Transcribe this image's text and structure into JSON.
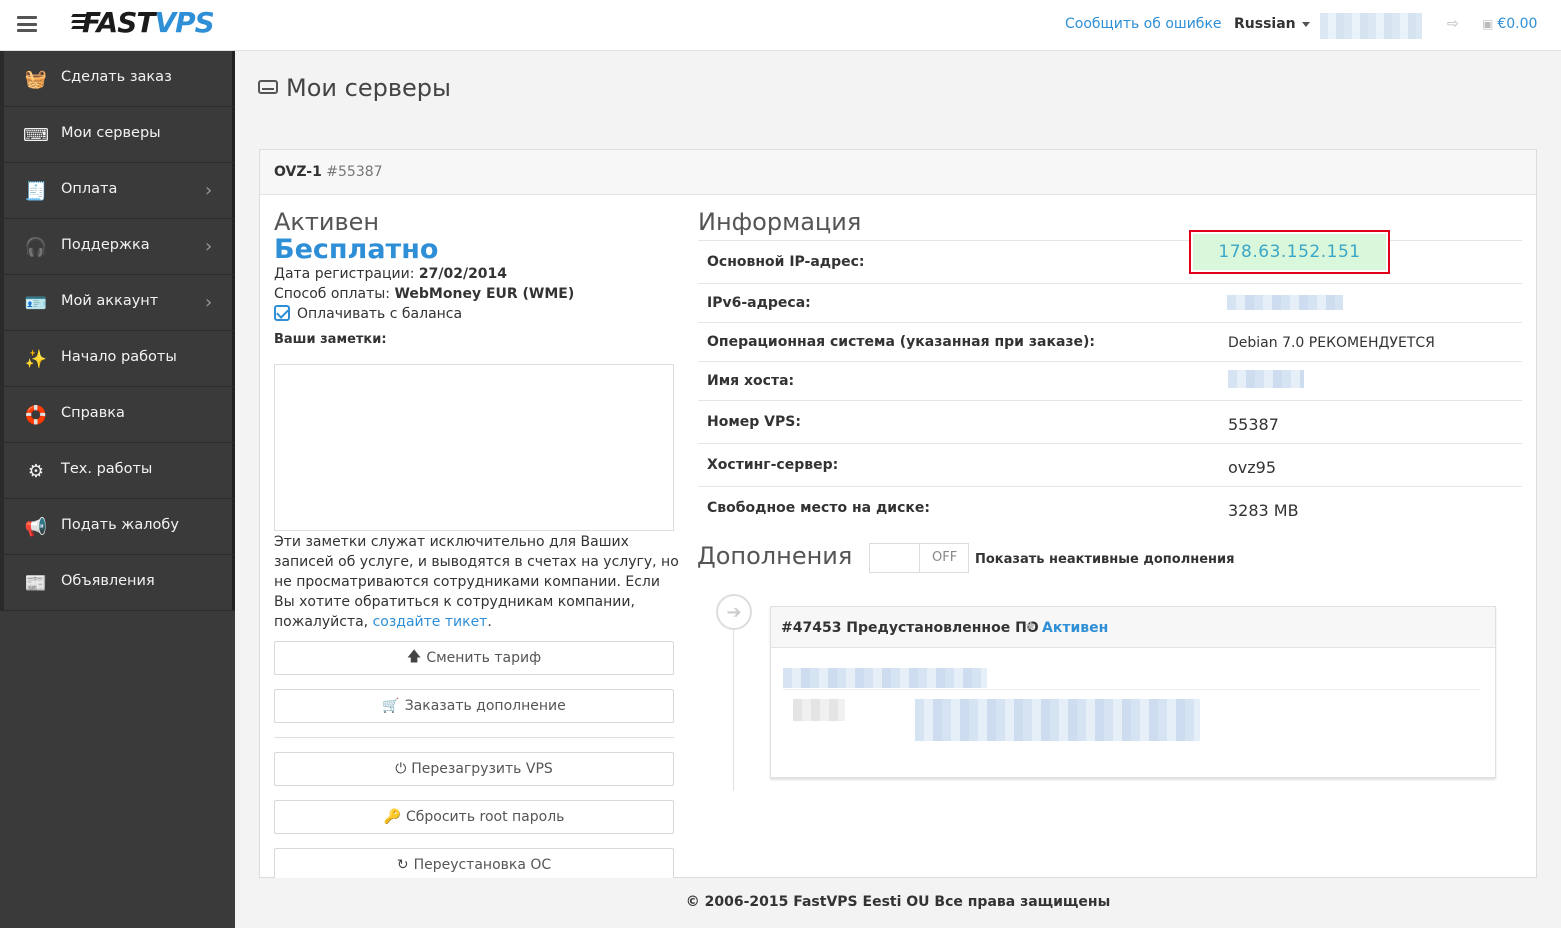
{
  "header": {
    "logo_fast": "FAST",
    "logo_vps": "VPS",
    "report_link": "Сообщить об ошибке",
    "language": "Russian",
    "balance": "€0.00"
  },
  "sidebar": {
    "items": [
      {
        "label": "Сделать заказ",
        "icon": "basket-icon",
        "glyph": "🧺",
        "chevron": false
      },
      {
        "label": "Мои серверы",
        "icon": "keyboard-icon",
        "glyph": "⌨",
        "chevron": false
      },
      {
        "label": "Оплата",
        "icon": "invoice-icon",
        "glyph": "🧾",
        "chevron": true
      },
      {
        "label": "Поддержка",
        "icon": "headphones-icon",
        "glyph": "🎧",
        "chevron": true
      },
      {
        "label": "Мой аккаунт",
        "icon": "id-card-icon",
        "glyph": "🪪",
        "chevron": true
      },
      {
        "label": "Начало работы",
        "icon": "magic-wand-icon",
        "glyph": "✨",
        "chevron": false
      },
      {
        "label": "Справка",
        "icon": "lifebuoy-icon",
        "glyph": "🛟",
        "chevron": false
      },
      {
        "label": "Тех. работы",
        "icon": "gear-icon",
        "glyph": "⚙",
        "chevron": false
      },
      {
        "label": "Подать жалобу",
        "icon": "megaphone-icon",
        "glyph": "📢",
        "chevron": false
      },
      {
        "label": "Объявления",
        "icon": "newspaper-icon",
        "glyph": "📰",
        "chevron": false
      }
    ]
  },
  "page": {
    "title": "Мои серверы"
  },
  "server": {
    "name": "OVZ-1",
    "number": "#55387",
    "status": "Активен",
    "price": "Бесплатно",
    "reg_date_label": "Дата регистрации:",
    "reg_date": "27/02/2014",
    "payment_label": "Способ оплаты:",
    "payment": "WebMoney EUR (WME)",
    "pay_from_balance": "Оплачивать с баланса",
    "notes_label": "Ваши заметки:",
    "notes_help": "Эти заметки служат исключительно для Ваших записей об услуге, и выводятся в счетах на услугу, но не просматриваются сотрудниками компании. Если Вы хотите обратиться к сотрудникам компании, пожалуйста, ",
    "notes_help_link": "создайте тикет",
    "notes_help_end": "."
  },
  "actions": {
    "change_plan": "Сменить тариф",
    "order_addon": "Заказать дополнение",
    "reboot": "Перезагрузить VPS",
    "reset_root": "Сбросить root пароль",
    "reinstall": "Переустановка ОС"
  },
  "info": {
    "title": "Информация",
    "rows": [
      {
        "label": "Основной IP-адрес:",
        "value": "178.63.152.151"
      },
      {
        "label": "IPv6-адреса:",
        "value": ""
      },
      {
        "label": "Операционная система (указанная при заказе):",
        "value": "Debian 7.0 РЕКОМЕНДУЕТСЯ"
      },
      {
        "label": "Имя хоста:",
        "value": ""
      },
      {
        "label": "Номер VPS:",
        "value": "55387"
      },
      {
        "label": "Хостинг-сервер:",
        "value": "ovz95"
      },
      {
        "label": "Свободное место на диске:",
        "value": "3283 MB"
      }
    ]
  },
  "addons": {
    "title": "Дополнения",
    "toggle_state": "OFF",
    "toggle_label": "Показать неактивные дополнения",
    "card": {
      "name": "#47453 Предустановленное ПО",
      "state": "Активен"
    }
  },
  "footer": {
    "copyright": "© 2006-2015 FastVPS Eesti OU Все права защищены"
  }
}
